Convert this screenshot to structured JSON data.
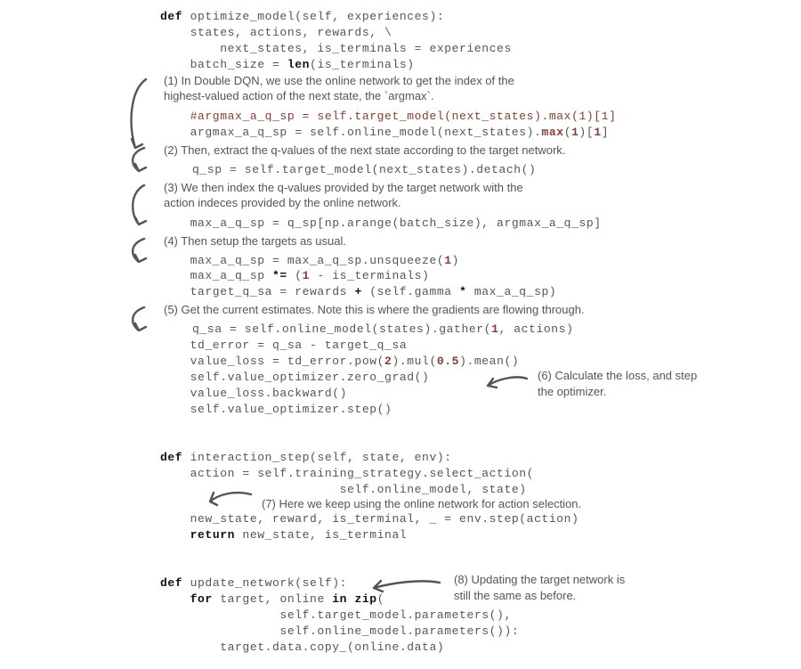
{
  "code": {
    "l1_a": "def",
    "l1_b": " optimize_model(self, experiences):",
    "l2": "    states, actions, rewards, \\",
    "l3": "        next_states, is_terminals = experiences",
    "l4_a": "    batch_size = ",
    "l4_b": "len",
    "l4_c": "(is_terminals)",
    "l5": "    #argmax_a_q_sp = self.target_model(next_states).max(1)[1]",
    "l6_a": "    argmax_a_q_sp = self.online_model(next_states).",
    "l6_b": "max",
    "l6_c": "(",
    "l6_d": "1",
    "l6_e": ")[",
    "l6_f": "1",
    "l6_g": "]",
    "l7": "q_sp = self.target_model(next_states).detach()",
    "l8": "    max_a_q_sp = q_sp[np.arange(batch_size), argmax_a_q_sp]",
    "l9_a": "    max_a_q_sp = max_a_q_sp.unsqueeze(",
    "l9_b": "1",
    "l9_c": ")",
    "l10_a": "    max_a_q_sp ",
    "l10_b": "*=",
    "l10_c": " (",
    "l10_d": "1",
    "l10_e": " - is_terminals)",
    "l11_a": "    target_q_sa = rewards ",
    "l11_b": "+",
    "l11_c": " (self.gamma ",
    "l11_d": "*",
    "l11_e": " max_a_q_sp)",
    "l12_a": "q_sa = self.online_model(states).gather(",
    "l12_b": "1",
    "l12_c": ", actions)",
    "l13": "    td_error = q_sa - target_q_sa",
    "l14_a": "    value_loss = td_error.pow(",
    "l14_b": "2",
    "l14_c": ").mul(",
    "l14_d": "0.5",
    "l14_e": ").mean()",
    "l15": "    self.value_optimizer.zero_grad()",
    "l16": "    value_loss.backward()",
    "l17": "    self.value_optimizer.step()",
    "l18_a": "def",
    "l18_b": " interaction_step(self, state, env):",
    "l19": "    action = self.training_strategy.select_action(",
    "l20": "                        self.online_model, state)",
    "l21": "    new_state, reward, is_terminal, _ = env.step(action)",
    "l22_a": "    ",
    "l22_b": "return",
    "l22_c": " new_state, is_terminal",
    "l23_a": "def",
    "l23_b": " update_network(self):",
    "l24_a": "    ",
    "l24_b": "for",
    "l24_c": " target, online ",
    "l24_d": "in",
    "l24_e": " ",
    "l24_f": "zip",
    "l24_g": "(",
    "l25": "                self.target_model.parameters(),",
    "l26": "                self.online_model.parameters()):",
    "l27": "        target.data.copy_(online.data)"
  },
  "ann": {
    "a1": "(1) In Double DQN, we use the online network to get the index of the highest-valued action of the next state, the `argmax`.",
    "a2": "(2) Then, extract the q-values of the next state according to the target network.",
    "a3": "(3) We then index the q-values provided by the target network with the action indeces provided by the online network.",
    "a4": "(4) Then setup the targets as usual.",
    "a5": "(5) Get the current estimates. Note this is where the gradients are flowing through.",
    "a6": "(6) Calculate the loss, and step the optimizer.",
    "a7": "(7) Here we keep using the online network for action selection.",
    "a8": "(8) Updating the target net­work is still the same as before."
  }
}
